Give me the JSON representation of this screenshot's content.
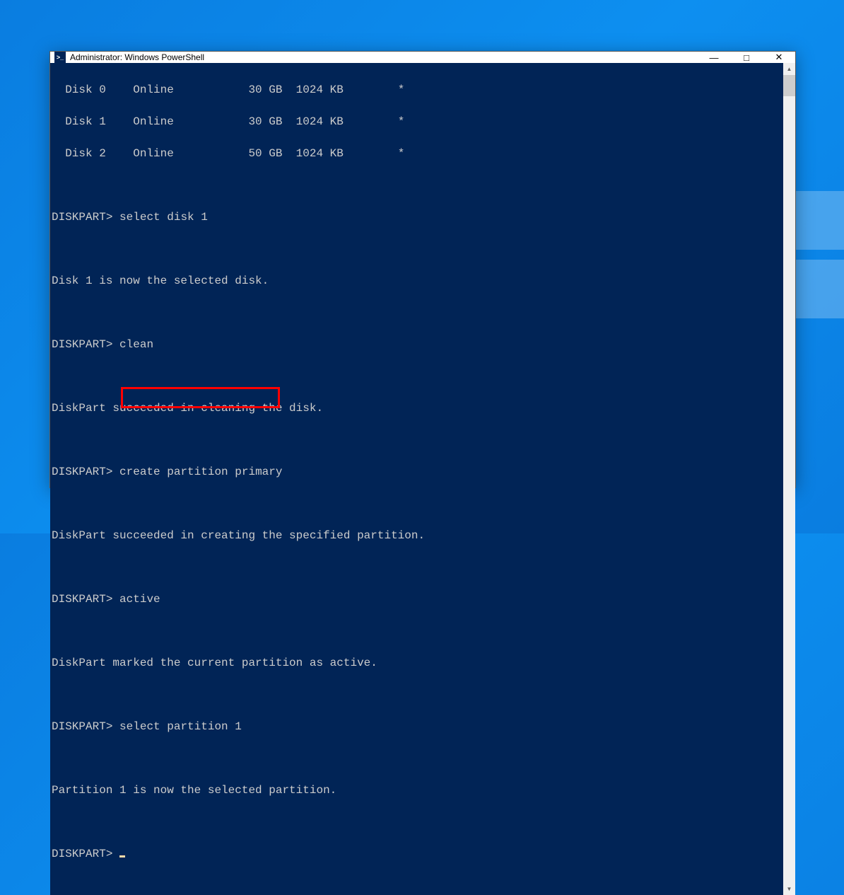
{
  "window": {
    "title": "Administrator: Windows PowerShell",
    "icon_label": ">_"
  },
  "prompt": "DISKPART>",
  "disks": [
    {
      "name": "Disk 0",
      "status": "Online",
      "size": "30 GB",
      "free": "1024 KB",
      "dyn": "*"
    },
    {
      "name": "Disk 1",
      "status": "Online",
      "size": "30 GB",
      "free": "1024 KB",
      "dyn": "*"
    },
    {
      "name": "Disk 2",
      "status": "Online",
      "size": "50 GB",
      "free": "1024 KB",
      "dyn": "*"
    }
  ],
  "commands": {
    "select_disk": "select disk 1",
    "clean": "clean",
    "create_partition": "create partition primary",
    "active": "active",
    "select_partition": "select partition 1"
  },
  "messages": {
    "disk_selected": "Disk 1 is now the selected disk.",
    "clean_ok": "DiskPart succeeded in cleaning the disk.",
    "create_ok": "DiskPart succeeded in creating the specified partition.",
    "active_ok": "DiskPart marked the current partition as active.",
    "partition_selected": "Partition 1 is now the selected partition."
  },
  "highlight_command": "select partition 1"
}
